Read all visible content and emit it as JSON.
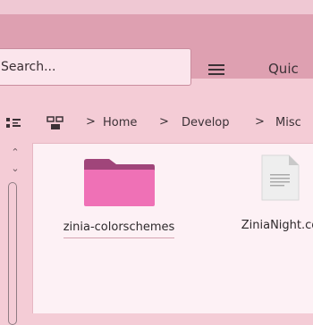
{
  "toolbar": {
    "search_placeholder": "Search...",
    "menu_icon": "hamburger-icon",
    "quick_label": "Quic"
  },
  "breadcrumb": {
    "items": [
      "Home",
      "Develop",
      "Misc"
    ],
    "separator": ">"
  },
  "files": [
    {
      "name": "zinia-colorschemes",
      "type": "folder"
    },
    {
      "name": "ZiniaNight.co",
      "type": "document"
    }
  ],
  "colors": {
    "toolbar_bg": "#dea0b1",
    "folder": "#ef71b6",
    "content_bg": "#fdf1f5"
  }
}
